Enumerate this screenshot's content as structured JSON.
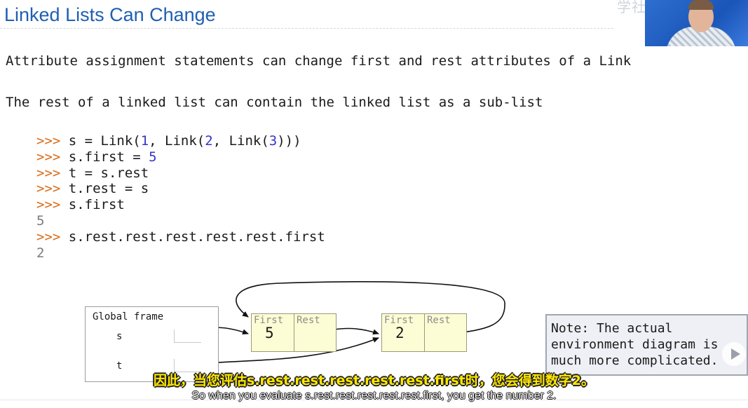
{
  "slide": {
    "title": "Linked Lists Can Change",
    "watermark": "学社区",
    "line1": "Attribute assignment statements can change first and rest attributes of a Link",
    "line2": "The rest of a linked list can contain the linked list as a sub-list"
  },
  "code": [
    {
      "prompt": ">>> ",
      "segments": [
        {
          "t": "s = Link("
        },
        {
          "t": "1",
          "c": "num"
        },
        {
          "t": ", Link("
        },
        {
          "t": "2",
          "c": "num"
        },
        {
          "t": ", Link("
        },
        {
          "t": "3",
          "c": "num"
        },
        {
          "t": ")))"
        }
      ]
    },
    {
      "prompt": ">>> ",
      "segments": [
        {
          "t": "s.first = "
        },
        {
          "t": "5",
          "c": "num"
        }
      ]
    },
    {
      "prompt": ">>> ",
      "segments": [
        {
          "t": "t = s.rest"
        }
      ]
    },
    {
      "prompt": ">>> ",
      "segments": [
        {
          "t": "t.rest = s"
        }
      ]
    },
    {
      "prompt": ">>> ",
      "segments": [
        {
          "t": "s.first"
        }
      ]
    },
    {
      "prompt": "",
      "segments": [
        {
          "t": "5",
          "c": "output"
        }
      ]
    },
    {
      "prompt": ">>> ",
      "segments": [
        {
          "t": "s.rest.rest.rest.rest.rest.first"
        }
      ]
    },
    {
      "prompt": "",
      "segments": [
        {
          "t": "2",
          "c": "output"
        }
      ]
    }
  ],
  "diagram": {
    "frame_title": "Global frame",
    "var_s": "s",
    "var_t": "t",
    "link1": {
      "first_label": "First",
      "rest_label": "Rest",
      "first_value": "5"
    },
    "link2": {
      "first_label": "First",
      "rest_label": "Rest",
      "first_value": "2"
    }
  },
  "note": "Note: The actual\nenvironment diagram is\nmuch more complicated.",
  "subtitles": {
    "cn": "因此，当您评估s.rest.rest.rest.rest.rest.first时，您会得到数字2。",
    "en": "So when you evaluate s.rest.rest.rest.rest.rest.first, you get the number 2."
  },
  "colors": {
    "title": "#1f5fb2",
    "prompt": "#d96b17",
    "number": "#3535c8",
    "link_box": "#fdfdd5"
  },
  "icons": {
    "video_play": "play-icon",
    "webcam": "presenter-video"
  }
}
